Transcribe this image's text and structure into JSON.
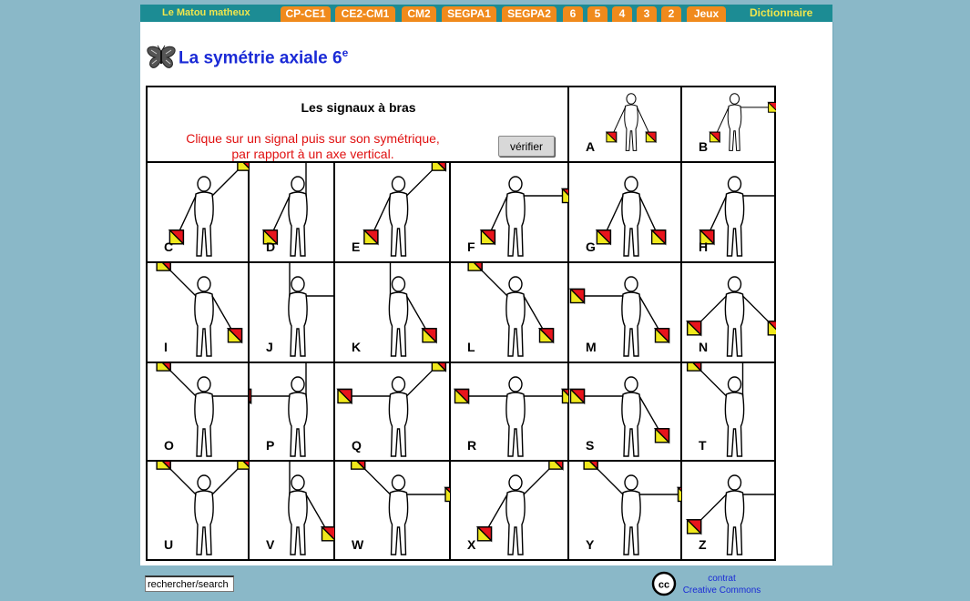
{
  "nav": {
    "brand": "Le Matou matheux",
    "tabs": [
      "CP-CE1",
      "CE2-CM1",
      "CM2",
      "SEGPA1",
      "SEGPA2",
      "6",
      "5",
      "4",
      "3",
      "2",
      "Jeux"
    ],
    "dictionary": "Dictionnaire"
  },
  "page": {
    "title": "La symétrie axiale 6",
    "title_sup": "e"
  },
  "exercise": {
    "title": "Les signaux à bras",
    "instruction_line1": "Clique sur un signal puis sur son symétrique,",
    "instruction_line2": "par rapport à un axe vertical.",
    "verify_button": "vérifier"
  },
  "signals": [
    "A",
    "B",
    "C",
    "D",
    "E",
    "F",
    "G",
    "H",
    "I",
    "J",
    "K",
    "L",
    "M",
    "N",
    "O",
    "P",
    "Q",
    "R",
    "S",
    "T",
    "U",
    "V",
    "W",
    "X",
    "Y",
    "Z"
  ],
  "footer": {
    "search_value": "rechercher/search",
    "license_line1": "contrat",
    "license_line2": "Creative Commons"
  },
  "colors": {
    "navbar": "#1c8c94",
    "tab": "#f08a1c",
    "brand_text": "#f0e64c",
    "title": "#1a2ad6",
    "instruction": "#e01010",
    "flag_red": "#e8141c",
    "flag_yellow": "#f0e81c"
  }
}
